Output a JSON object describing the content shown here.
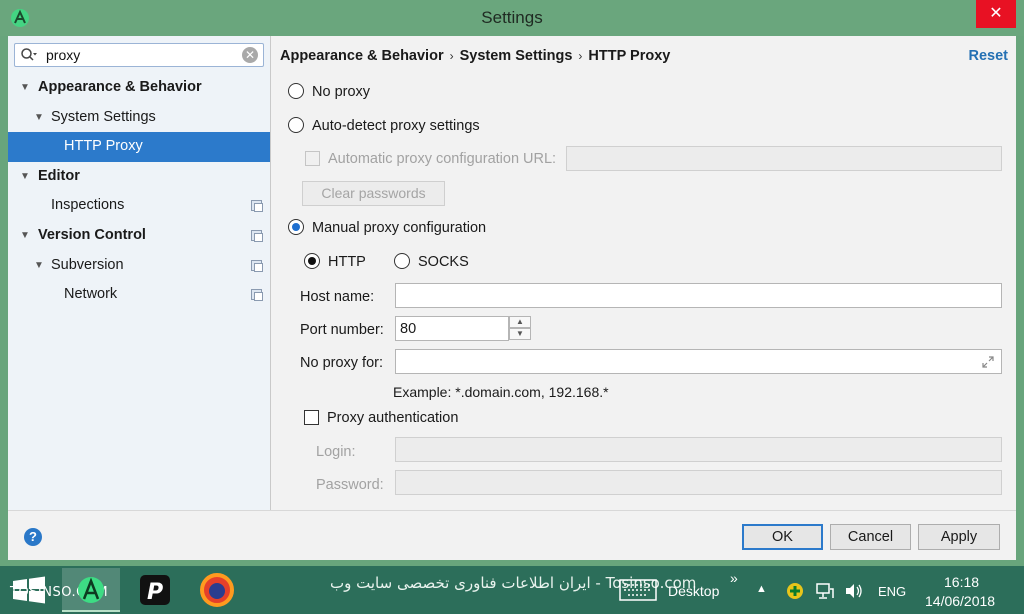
{
  "window": {
    "title": "Settings",
    "close_glyph": "✕"
  },
  "search": {
    "value": "proxy",
    "clear_glyph": "✕"
  },
  "tree": [
    {
      "label": "Appearance & Behavior",
      "level": 0,
      "bold": true,
      "expanded": true
    },
    {
      "label": "System Settings",
      "level": 1,
      "bold": false,
      "expanded": true
    },
    {
      "label": "HTTP Proxy",
      "level": 2,
      "bold": false,
      "selected": true
    },
    {
      "label": "Editor",
      "level": 0,
      "bold": true,
      "expanded": true
    },
    {
      "label": "Inspections",
      "level": 1,
      "bold": false,
      "copy": true
    },
    {
      "label": "Version Control",
      "level": 0,
      "bold": true,
      "expanded": true,
      "copy": true
    },
    {
      "label": "Subversion",
      "level": 1,
      "bold": false,
      "expanded": true,
      "copy": true
    },
    {
      "label": "Network",
      "level": 2,
      "bold": false,
      "copy": true
    }
  ],
  "breadcrumb": [
    "Appearance & Behavior",
    "System Settings",
    "HTTP Proxy"
  ],
  "reset_label": "Reset",
  "proxy": {
    "no_proxy": "No proxy",
    "auto_detect": "Auto-detect proxy settings",
    "auto_config_url_label": "Automatic proxy configuration URL:",
    "clear_passwords": "Clear passwords",
    "manual": "Manual proxy configuration",
    "http": "HTTP",
    "socks": "SOCKS",
    "host_label": "Host name:",
    "host_value": "",
    "port_label": "Port number:",
    "port_value": "80",
    "no_proxy_for_label": "No proxy for:",
    "no_proxy_for_value": "",
    "example": "Example: *.domain.com, 192.168.*",
    "auth_label": "Proxy authentication",
    "login_label": "Login:",
    "password_label": "Password:"
  },
  "buttons": {
    "ok": "OK",
    "cancel": "Cancel",
    "apply": "Apply",
    "help": "?"
  },
  "taskbar": {
    "watermark_left": "TOSINSO.COM",
    "watermark_center": "ایران اطلاعات فناوری تخصصی سایت وب - Tosinso.com",
    "desktop": "Desktop",
    "chevron": "»",
    "language": "ENG",
    "time": "16:18",
    "date": "14/06/2018"
  },
  "colors": {
    "selection": "#2c7acb",
    "accent_link": "#2470b3",
    "title_bar": "#6aa67d",
    "taskbar": "#2c6e5a"
  }
}
